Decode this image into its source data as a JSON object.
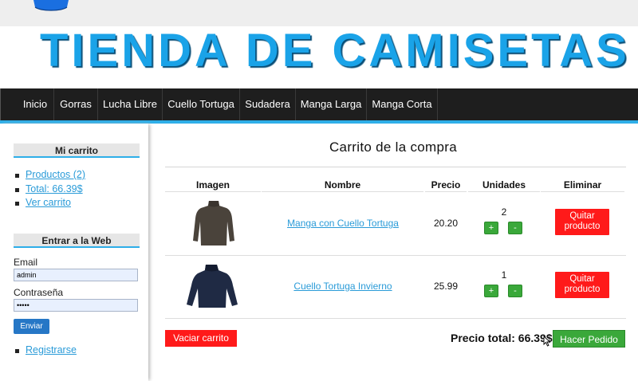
{
  "site": {
    "title": "TIENDA DE CAMISETAS"
  },
  "nav": {
    "items": [
      "Inicio",
      "Gorras",
      "Lucha Libre",
      "Cuello Tortuga",
      "Sudadera",
      "Manga Larga",
      "Manga Corta"
    ]
  },
  "sidebar": {
    "cart_heading": "Mi carrito",
    "cart_links": [
      "Productos (2)",
      "Total: 66.39$",
      "Ver carrito"
    ],
    "login_heading": "Entrar a la Web",
    "email_label": "Email",
    "email_value": "admin",
    "password_label": "Contraseña",
    "password_value": "•••••",
    "send_label": "Enviar",
    "register_label": "Registrarse"
  },
  "cart": {
    "title": "Carrito de la compra",
    "columns": [
      "Imagen",
      "Nombre",
      "Precio",
      "Unidades",
      "Eliminar"
    ],
    "rows": [
      {
        "name": "Manga con Cuello Tortuga",
        "price": "20.20",
        "units": "2",
        "image": "brown-turtleneck-image"
      },
      {
        "name": "Cuello Tortuga Invierno",
        "price": "25.99",
        "units": "1",
        "image": "navy-turtleneck-image"
      }
    ],
    "plus_label": "+",
    "minus_label": "-",
    "remove_label": "Quitar producto",
    "empty_label": "Vaciar carrito",
    "total_label": "Precio total: 66.39$",
    "order_label": "Hacer Pedido"
  },
  "colors": {
    "title_blue": "#1aa3e8",
    "nav_bg": "#1e1e1e",
    "accent_blue": "#2eaee8",
    "danger_red": "#ff1a1a",
    "success_green": "#3aa83a"
  }
}
